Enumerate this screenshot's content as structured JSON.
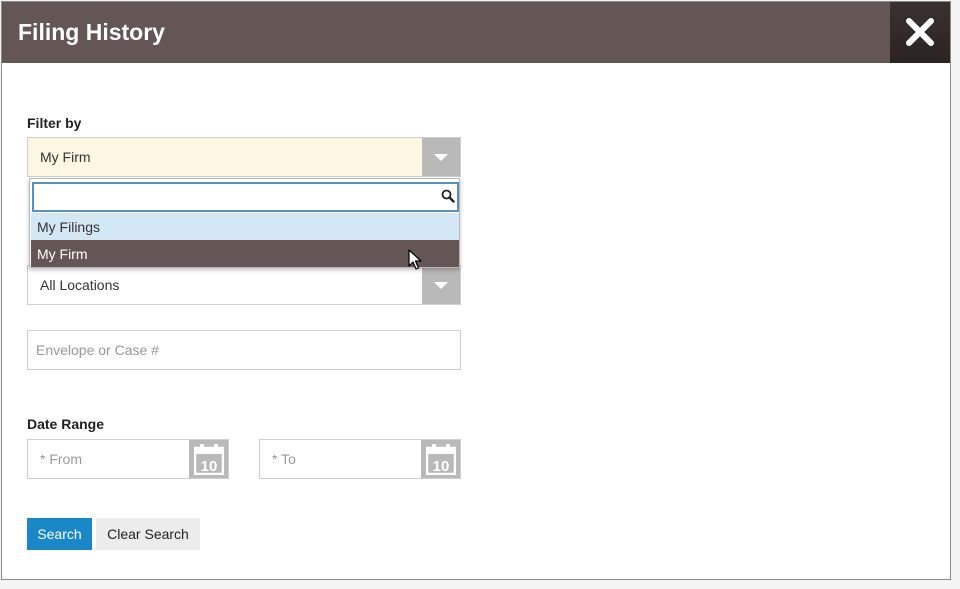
{
  "dialog": {
    "title": "Filing History"
  },
  "filter": {
    "label": "Filter by",
    "selected": "My Firm",
    "search_value": "",
    "options": [
      "My Filings",
      "My Firm"
    ]
  },
  "location": {
    "selected": "All Locations"
  },
  "envelope": {
    "placeholder": "Envelope or Case #"
  },
  "date_range": {
    "label": "Date Range",
    "from_placeholder": "* From",
    "to_placeholder": "* To",
    "calendar_day": "10"
  },
  "actions": {
    "search_label": "Search",
    "clear_label": "Clear Search"
  },
  "colors": {
    "header": "#635655",
    "accent": "#1a87c8",
    "selected_field_bg": "#fdf6e3",
    "hover_option_bg": "#d4e7f4"
  }
}
